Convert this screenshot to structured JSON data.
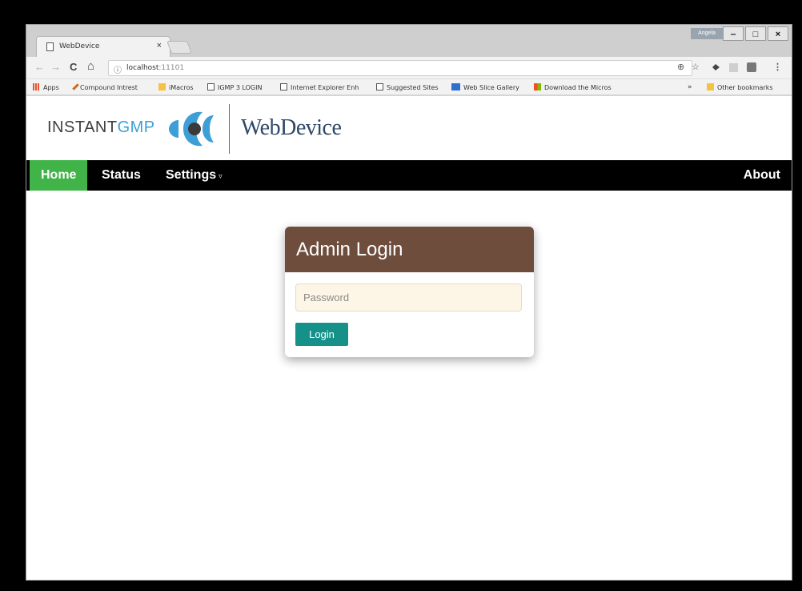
{
  "browser": {
    "tab_title": "WebDevice",
    "tab_close": "×",
    "profile": "Angela",
    "minimize": "‒",
    "maximize": "□",
    "close": "×",
    "back": "←",
    "forward": "→",
    "reload": "C",
    "home": "⌂",
    "info_icon": "ⓘ",
    "url_host": "localhost",
    "url_port": ":11101",
    "zoom_icon": "⊕",
    "star_icon": "☆",
    "menu_icon": "⋮",
    "overflow": "»"
  },
  "bookmarks": [
    {
      "label": "Apps",
      "icon": "apps-grid-icon",
      "color": "#e8542f"
    },
    {
      "label": "Compound Intrest",
      "icon": "hammer-icon",
      "color": "#d2691e"
    },
    {
      "label": "iMacros",
      "icon": "folder-icon",
      "color": "#f5c242"
    },
    {
      "label": "IGMP 3 LOGIN",
      "icon": "page-icon",
      "color": "#ffffff"
    },
    {
      "label": "Internet Explorer Enh",
      "icon": "page-icon",
      "color": "#ffffff"
    },
    {
      "label": "Suggested Sites",
      "icon": "page-icon",
      "color": "#ffffff"
    },
    {
      "label": "Web Slice Gallery",
      "icon": "webslice-icon",
      "color": "#2f6fd0"
    },
    {
      "label": "Download the Micros",
      "icon": "windows-icon",
      "color": "#f25022"
    },
    {
      "label": "Other bookmarks",
      "icon": "folder-icon",
      "color": "#f5c242"
    }
  ],
  "header": {
    "brand_instant": "INSTANT",
    "brand_gmp": "GMP",
    "app_name": "WebDevice"
  },
  "nav": {
    "home": "Home",
    "status": "Status",
    "settings": "Settings",
    "settings_caret": "▿",
    "about": "About"
  },
  "login": {
    "title": "Admin Login",
    "password_placeholder": "Password",
    "password_value": "",
    "button": "Login"
  },
  "colors": {
    "nav_active": "#41b449",
    "card_header": "#6f4d3d",
    "login_button": "#15918a",
    "brand_blue": "#3d9fd6"
  }
}
